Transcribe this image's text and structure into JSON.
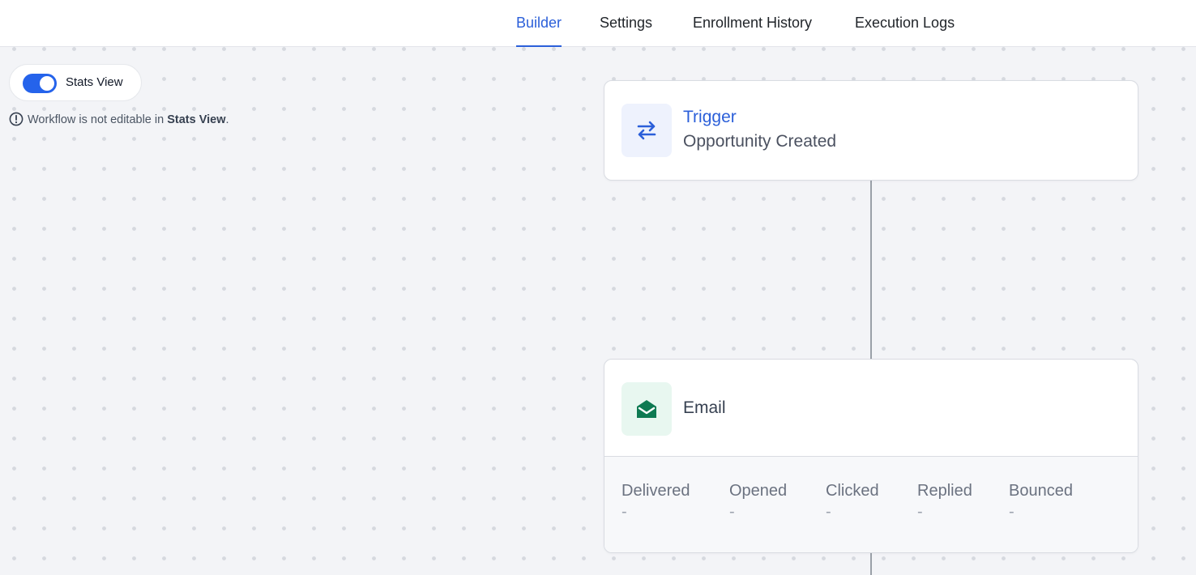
{
  "tabs": [
    {
      "label": "Builder",
      "active": true
    },
    {
      "label": "Settings",
      "active": false
    },
    {
      "label": "Enrollment History",
      "active": false
    },
    {
      "label": "Execution Logs",
      "active": false
    }
  ],
  "stats_view": {
    "label": "Stats View",
    "enabled": true
  },
  "notice": {
    "prefix": "Workflow is not editable in ",
    "emphasis": "Stats View",
    "suffix": "."
  },
  "trigger_node": {
    "icon": "arrows-swap-icon",
    "title": "Trigger",
    "subtitle": "Opportunity Created"
  },
  "email_node": {
    "icon": "open-envelope-icon",
    "title": "Email",
    "stats": [
      {
        "label": "Delivered",
        "value": "-"
      },
      {
        "label": "Opened",
        "value": "-"
      },
      {
        "label": "Clicked",
        "value": "-"
      },
      {
        "label": "Replied",
        "value": "-"
      },
      {
        "label": "Bounced",
        "value": "-"
      }
    ]
  },
  "colors": {
    "accent": "#2b5fd9",
    "toggle": "#2563eb",
    "email_icon": "#0e7a52"
  }
}
